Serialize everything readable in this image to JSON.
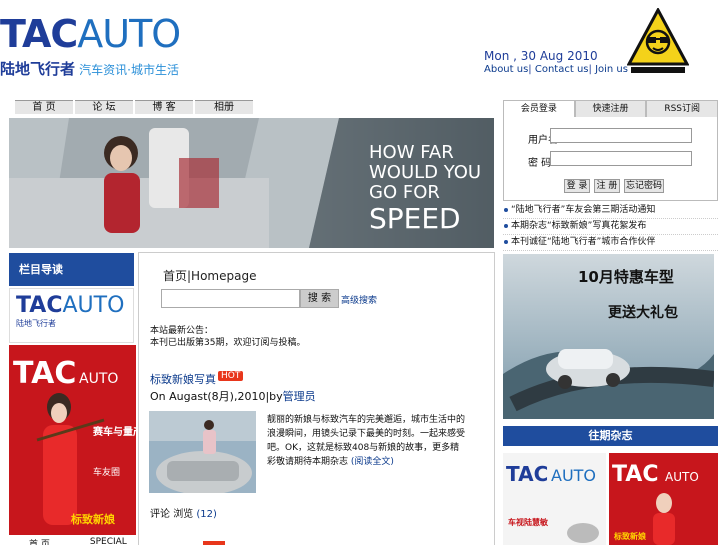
{
  "brand": {
    "logo_tac": "TAC",
    "logo_auto": "AUTO",
    "logo_cn": "陆地飞行者",
    "logo_tagline": "汽车资讯·城市生活"
  },
  "header": {
    "date": "Mon , 30 Aug 2010",
    "links": [
      "About us",
      "Contact us",
      "Join us"
    ],
    "separator": "|"
  },
  "nav": {
    "items": [
      "首 页",
      "论 坛",
      "博 客",
      "相册"
    ]
  },
  "banner": {
    "line1": "HOW FAR",
    "line2": "WOULD YOU",
    "line3": "GO FOR",
    "line4": "SPEED"
  },
  "left": {
    "heading": "栏目导读",
    "mini_logo_tac": "TAC",
    "mini_logo_auto": "AUTO",
    "mini_logo_cn": "陆地飞行者",
    "magazine_title_tac": "TAC",
    "magazine_title_auto": "AUTO",
    "magazine_cover_lines": [
      "赛车与量产",
      "车友圈",
      "标致新娘"
    ],
    "footer": [
      "首 页",
      "SPECIAL"
    ]
  },
  "center": {
    "breadcrumb": "首页|Homepage",
    "search_placeholder": "",
    "search_button": "搜 索",
    "advanced_link": "高级搜索",
    "notice_line1": "本站最新公告：",
    "notice_line2": "本刊已出版第35期，欢迎订阅与投稿。",
    "post": {
      "title": "标致新娘写真",
      "badge": "HOT",
      "meta_prefix": "On Augast(8月),2010|by",
      "author": "管理员",
      "excerpt": "靓丽的新娘与标致汽车的完美邂逅，城市生活中的浪漫瞬间，用镜头记录下最美的时刻。一起来感受吧。OK，这就是标致408与新娘的故事，更多精彩敬请期待本期杂志",
      "read_more": "(阅读全文)",
      "footer_label": "评论",
      "footer_label2": "浏览",
      "count": "(12)"
    }
  },
  "right": {
    "tabs": [
      "会员登录",
      "快速注册",
      "RSS订阅"
    ],
    "login": {
      "user_label": "用户名",
      "pass_label": "密  码",
      "buttons": [
        "登 录",
        "注 册",
        "忘记密码"
      ]
    },
    "news": [
      "“陆地飞行者”车友会第三期活动通知",
      "本期杂志“标致新娘”写真花絮发布",
      "本刊诚征“陆地飞行者”城市合作伙伴"
    ],
    "ad": {
      "line1": "10月特惠车型",
      "line2": "更送大礼包"
    },
    "past_heading": "往期杂志",
    "past_mags": [
      "车视陆慧敏",
      "标致新娘"
    ]
  }
}
